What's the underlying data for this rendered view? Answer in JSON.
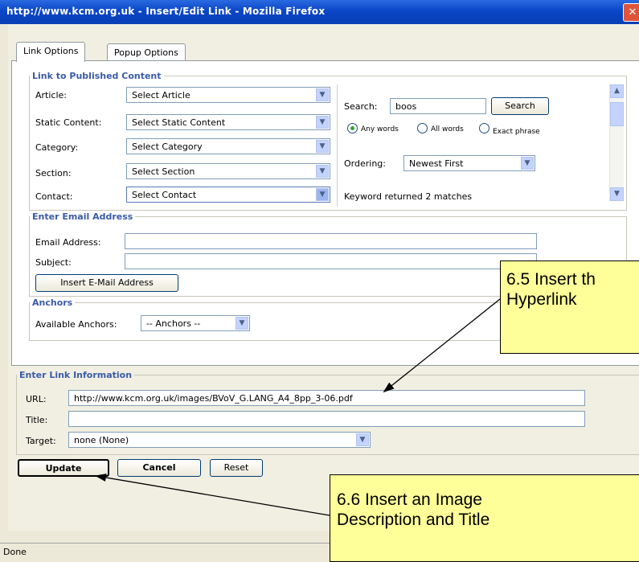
{
  "window": {
    "title": "http://www.kcm.org.uk - Insert/Edit Link - Mozilla Firefox",
    "close_icon": "close-icon"
  },
  "tabs": [
    {
      "label": "Link Options",
      "active": true
    },
    {
      "label": "Popup Options",
      "active": false
    }
  ],
  "published": {
    "legend": "Link to Published Content",
    "rows": [
      {
        "label": "Article:",
        "value": "Select Article"
      },
      {
        "label": "Static Content:",
        "value": "Select Static Content"
      },
      {
        "label": "Category:",
        "value": "Select Category"
      },
      {
        "label": "Section:",
        "value": "Select Section"
      },
      {
        "label": "Contact:",
        "value": "Select Contact"
      }
    ],
    "search": {
      "label": "Search:",
      "value": "boos",
      "button": "Search",
      "radios": [
        {
          "label": "Any words",
          "checked": true
        },
        {
          "label": "All words",
          "checked": false
        },
        {
          "label": "Exact phrase",
          "checked": false
        }
      ],
      "ordering_label": "Ordering:",
      "ordering_value": "Newest First",
      "result": "Keyword returned 2 matches"
    }
  },
  "email": {
    "legend": "Enter Email Address",
    "address_label": "Email Address:",
    "address_value": "",
    "subject_label": "Subject:",
    "subject_value": "",
    "insert_button": "Insert E-Mail Address"
  },
  "anchors": {
    "legend": "Anchors",
    "label": "Available Anchors:",
    "value": "-- Anchors --"
  },
  "link_info": {
    "legend": "Enter Link Information",
    "url_label": "URL:",
    "url_value": "http://www.kcm.org.uk/images/BVoV_G.LANG_A4_8pp_3-06.pdf",
    "title_label": "Title:",
    "title_value": "",
    "target_label": "Target:",
    "target_value": "none (None)"
  },
  "buttons": {
    "update": "Update",
    "cancel": "Cancel",
    "reset": "Reset"
  },
  "status": "Done",
  "callouts": {
    "hyperlink": {
      "line1": "6.5 Insert th",
      "line2": "Hyperlink"
    },
    "description": {
      "line1": "6.6 Insert an Image",
      "line2": "Description and Title"
    }
  },
  "colors": {
    "titlebar": "#0a46c8",
    "legend": "#3a5ba8",
    "callout": "#ffff99"
  }
}
